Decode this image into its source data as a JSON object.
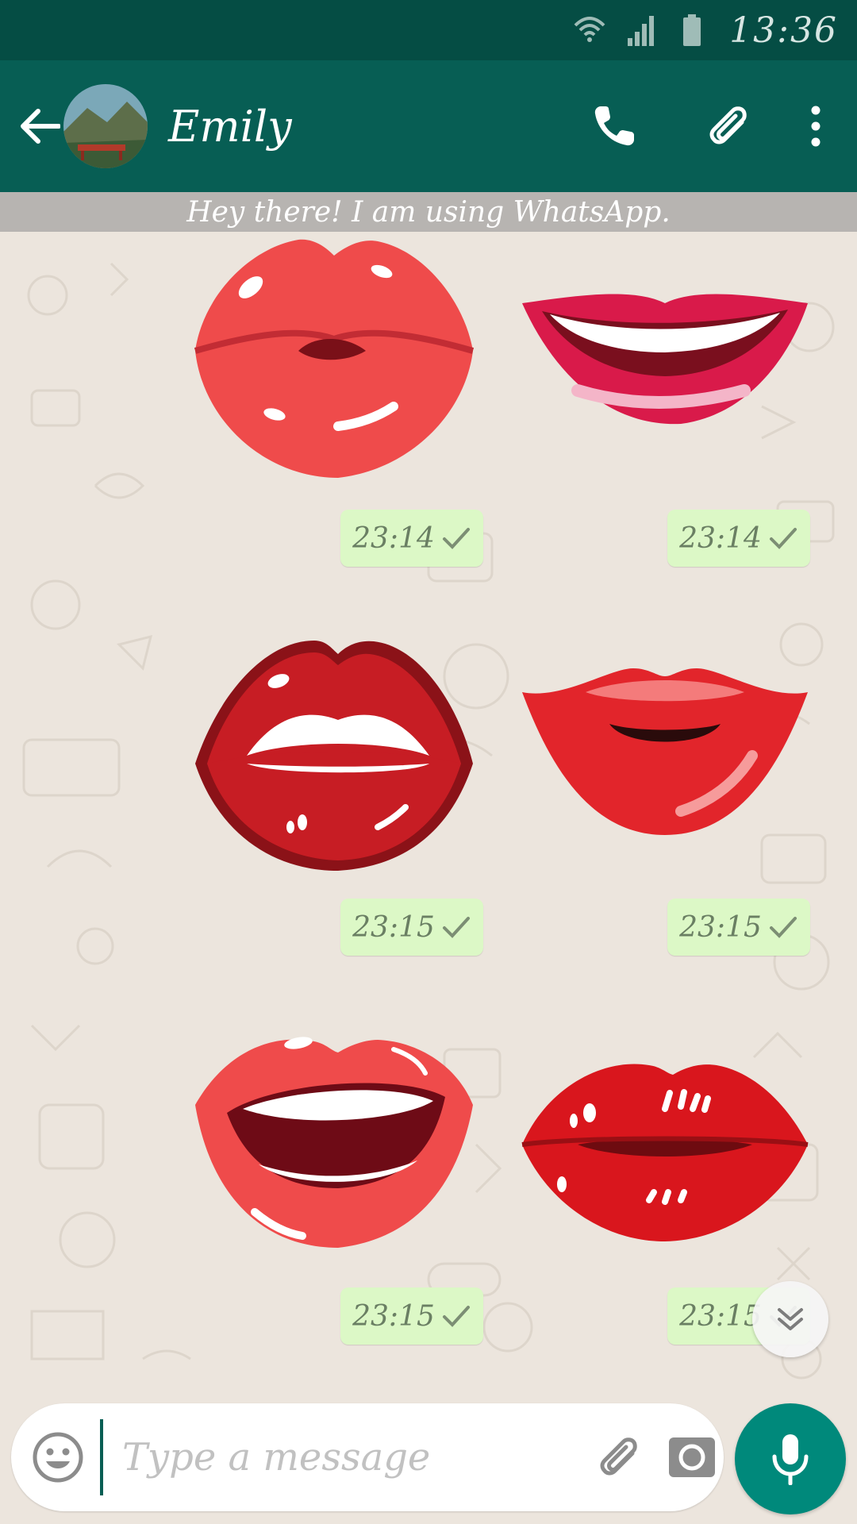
{
  "status_bar": {
    "time": "13:36",
    "icons": [
      "wifi-icon",
      "signal-icon",
      "battery-icon"
    ]
  },
  "header": {
    "contact_name": "Emily",
    "actions": [
      "back-arrow-icon",
      "phone-icon",
      "paperclip-icon",
      "more-vert-icon"
    ]
  },
  "status_message": "Hey there! I am using WhatsApp.",
  "messages": [
    {
      "type": "sticker",
      "name": "pouty-pink-lips",
      "time": "23:14"
    },
    {
      "type": "sticker",
      "name": "smiling-lips-teeth",
      "time": "23:14"
    },
    {
      "type": "sticker",
      "name": "dark-red-open-lips",
      "time": "23:15"
    },
    {
      "type": "sticker",
      "name": "red-lips-slightly-open",
      "time": "23:15"
    },
    {
      "type": "sticker",
      "name": "open-smile-lips",
      "time": "23:15"
    },
    {
      "type": "sticker",
      "name": "glossy-pucker-lips",
      "time": "23:15"
    }
  ],
  "composer": {
    "placeholder": "Type a message",
    "icons": [
      "emoji-icon",
      "paperclip-icon",
      "camera-icon",
      "microphone-icon"
    ]
  },
  "colors": {
    "statusbar": "#054d44",
    "appbar": "#075e54",
    "chat_bg": "#ece5dd",
    "outgoing_bubble": "#dcf8c6",
    "mic_fab": "#00897b"
  }
}
